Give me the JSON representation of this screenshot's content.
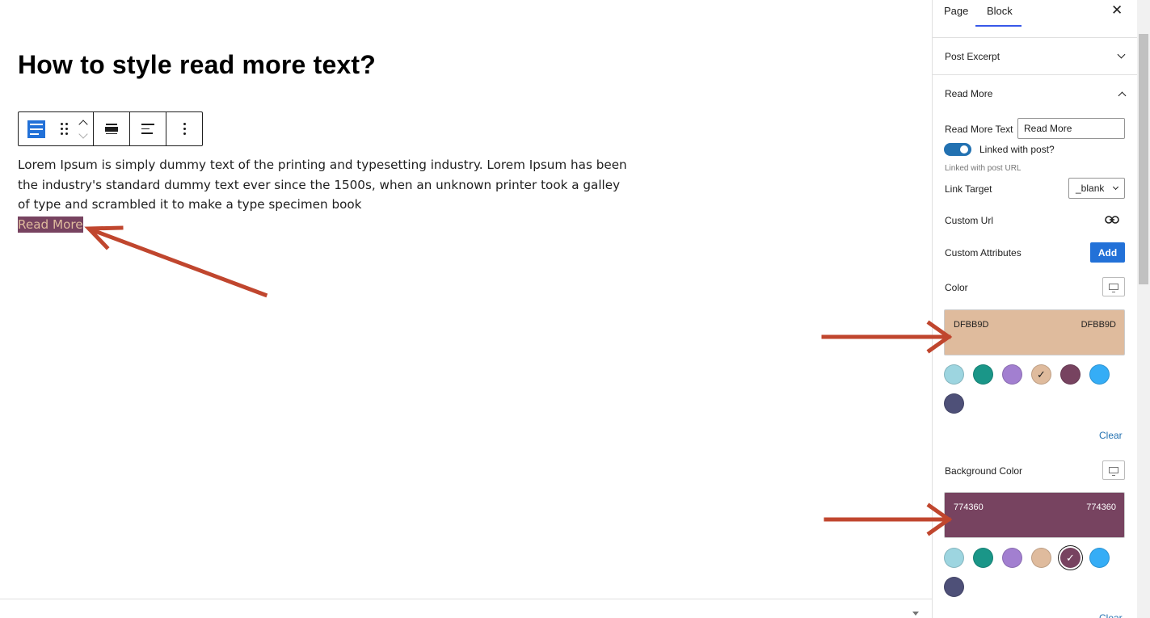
{
  "editor": {
    "post_title": "How to style read more text?",
    "paragraph": "Lorem Ipsum is simply dummy text of the printing and typesetting industry. Lorem Ipsum has been the industry's standard dummy text ever since the 1500s, when an unknown printer took a galley of type and scrambled it to make a type specimen book",
    "read_more_link": "Read More",
    "read_more_text_color": "#DFBB9D",
    "read_more_bg_color": "#774360"
  },
  "toolbar": {
    "icons": [
      "paragraph-icon",
      "drag-handle-icon",
      "move-up-icon",
      "move-down-icon",
      "align-wide-icon",
      "align-left-icon",
      "more-options-icon"
    ]
  },
  "sidebar": {
    "tabs": {
      "page": "Page",
      "block": "Block"
    },
    "panels": {
      "post_excerpt": "Post Excerpt",
      "read_more": "Read More"
    },
    "read_more_text_label": "Read More Text",
    "read_more_text_value": "Read More",
    "linked_toggle_label": "Linked with post?",
    "linked_help": "Linked with post URL",
    "link_target_label": "Link Target",
    "link_target_value": "_blank",
    "custom_url_label": "Custom Url",
    "custom_attributes_label": "Custom Attributes",
    "add_button": "Add",
    "color_label": "Color",
    "color_value": "DFBB9D",
    "color_hex": "#DFBB9D",
    "bg_color_label": "Background Color",
    "bg_color_value": "774360",
    "bg_color_hex": "#774360",
    "clear_label": "Clear",
    "palette": [
      "#9DD5E0",
      "#1A9688",
      "#A27FD0",
      "#DFBB9D",
      "#774360",
      "#35ADF6",
      "#4E5078"
    ]
  }
}
